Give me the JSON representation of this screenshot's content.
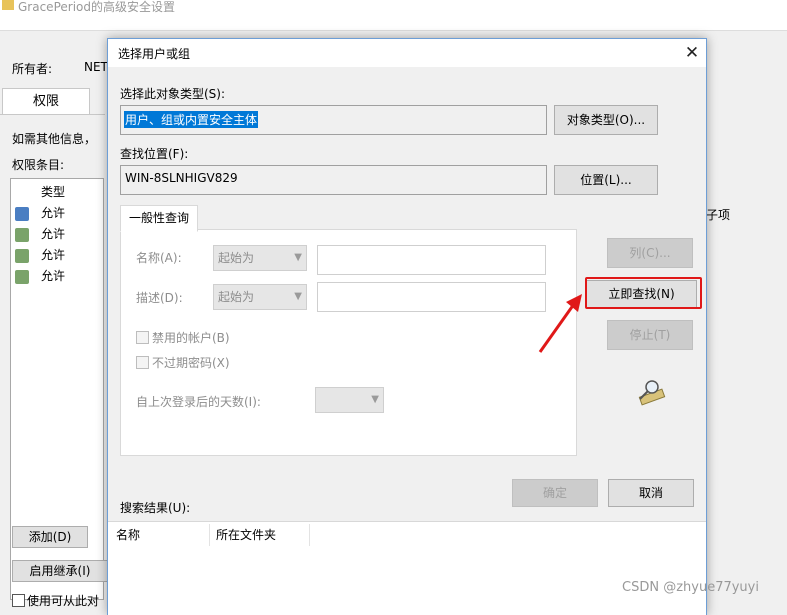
{
  "background_window": {
    "title": "GracePeriod的高级安全设置",
    "owner_label": "所有者:",
    "owner_value": "NET",
    "tab_permissions": "权限",
    "info_text": "如需其他信息，",
    "entries_label": "权限条目:",
    "col_type": "类型",
    "rows": [
      "允许",
      "允许",
      "允许",
      "允许"
    ],
    "right_fragment": "子项",
    "add_button": "添加(D)",
    "inherit_button": "启用继承(I)",
    "checkbox_label": "使用可从此对",
    "watermark": "CSDN @zhyue77yuyi"
  },
  "dialog": {
    "title": "选择用户或组",
    "object_type_label": "选择此对象类型(S):",
    "object_type_value": "用户、组或内置安全主体",
    "object_types_button": "对象类型(O)...",
    "location_label": "查找位置(F):",
    "location_value": "WIN-8SLNHIGV829",
    "locations_button": "位置(L)...",
    "query_tab": "一般性查询",
    "name_label": "名称(A):",
    "name_mode": "起始为",
    "desc_label": "描述(D):",
    "desc_mode": "起始为",
    "disabled_accounts": "禁用的帐户(B)",
    "non_expiring_pw": "不过期密码(X)",
    "days_since_logon": "自上次登录后的天数(I):",
    "columns_button": "列(C)...",
    "find_now_button": "立即查找(N)",
    "stop_button": "停止(T)",
    "ok_button": "确定",
    "cancel_button": "取消",
    "results_label": "搜索结果(U):",
    "results_columns": [
      "名称",
      "所在文件夹"
    ],
    "close_glyph": "✕"
  },
  "colors": {
    "highlight": "#e01818",
    "accent": "#0078d7"
  }
}
